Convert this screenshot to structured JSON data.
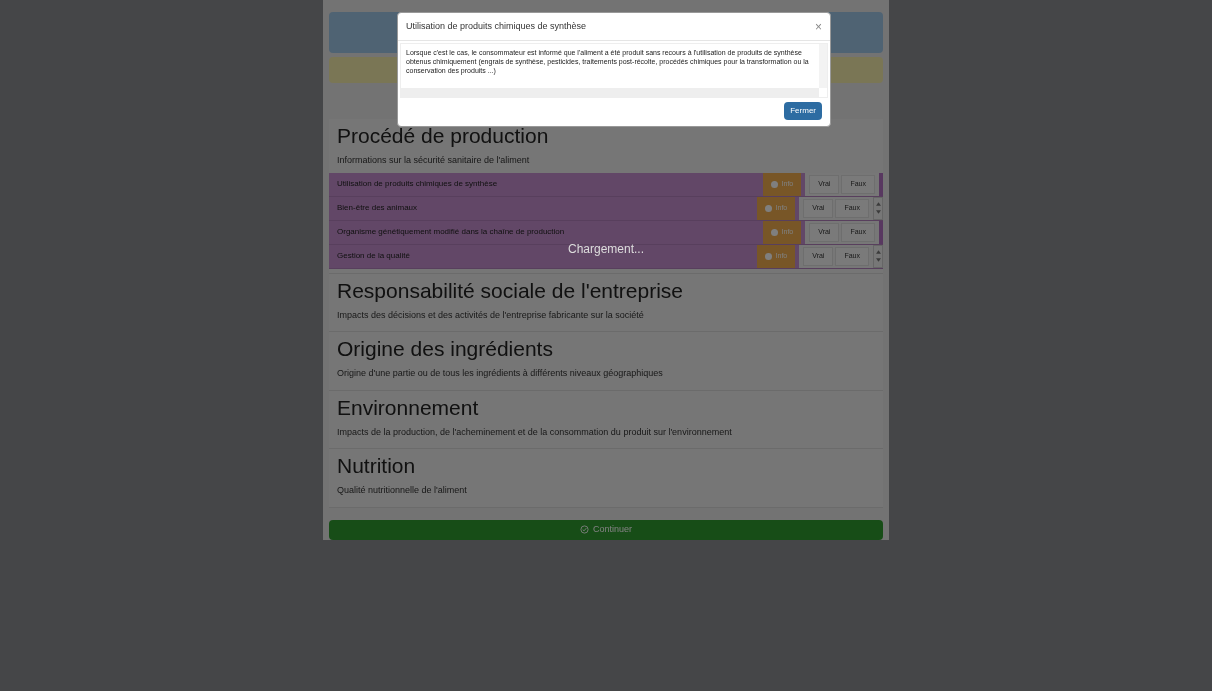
{
  "sections": [
    {
      "title": "Procédé de production",
      "description": "Informations sur la sécurité sanitaire de l'aliment",
      "rows": [
        {
          "label": "Utilisation de produits chimiques de synthèse",
          "info": "Info",
          "options": [
            "Vrai",
            "Faux"
          ],
          "spinner": false
        },
        {
          "label": "Bien-être des animaux",
          "info": "Info",
          "options": [
            "Vrai",
            "Faux"
          ],
          "spinner": true
        },
        {
          "label": "Organisme génétiquement modifié dans la chaîne de production",
          "info": "Info",
          "options": [
            "Vrai",
            "Faux"
          ],
          "spinner": false
        },
        {
          "label": "Gestion de la qualité",
          "info": "Info",
          "options": [
            "Vrai",
            "Faux"
          ],
          "spinner": true
        }
      ]
    },
    {
      "title": "Responsabilité sociale de l'entreprise",
      "description": "Impacts des décisions et des activités de l'entreprise fabricante sur la société"
    },
    {
      "title": "Origine des ingrédients",
      "description": "Origine d'une partie ou de tous les ingrédients à différents niveaux géographiques"
    },
    {
      "title": "Environnement",
      "description": "Impacts de la production, de l'acheminement et de la consommation du produit sur l'environnement"
    },
    {
      "title": "Nutrition",
      "description": "Qualité nutritionnelle de l'aliment"
    }
  ],
  "continue_button": "Continuer",
  "loading": "Chargement...",
  "modal": {
    "title": "Utilisation de produits chimiques de synthèse",
    "close": "×",
    "body": "Lorsque c'est le cas, le consommateur est informé que l'aliment a été produit sans recours à l'utilisation de produits de synthèse obtenus chimiquement (engrais de synthèse, pesticides, traitements post-récolte, procédés chimiques pour la transformation ou la conservation des produits ...)",
    "button": "Fermer"
  }
}
